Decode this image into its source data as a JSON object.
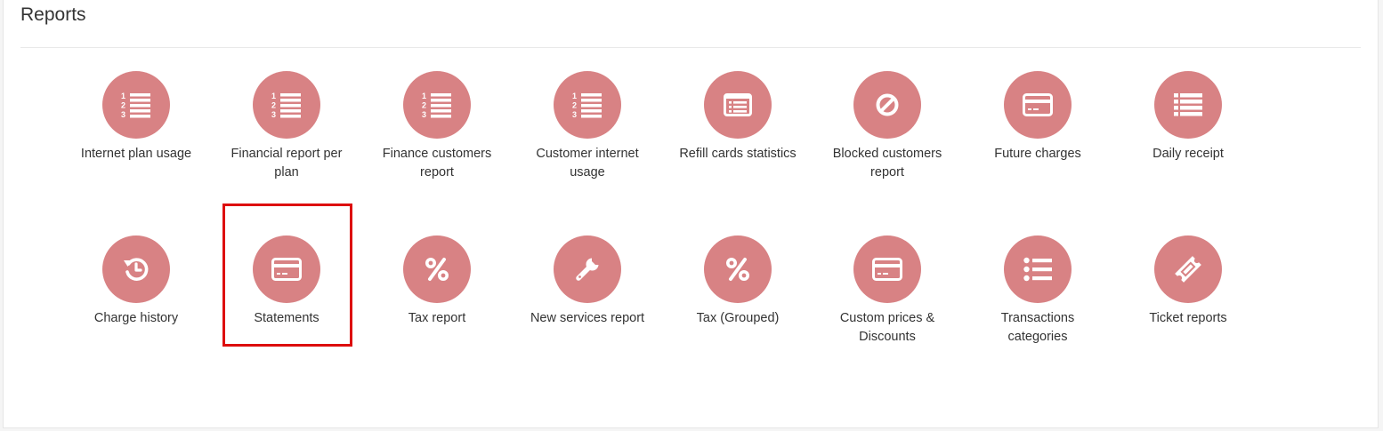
{
  "page": {
    "title": "Reports"
  },
  "colors": {
    "icon_circle": "#d88284",
    "highlight": "#dd0d0d",
    "icon_glyph": "#ffffff"
  },
  "reports": [
    {
      "label": "Internet plan usage",
      "icon": "ordered-list-icon"
    },
    {
      "label": "Financial report per plan",
      "icon": "ordered-list-icon"
    },
    {
      "label": "Finance customers report",
      "icon": "ordered-list-icon"
    },
    {
      "label": "Customer internet usage",
      "icon": "ordered-list-icon"
    },
    {
      "label": "Refill cards statistics",
      "icon": "list-alt-icon"
    },
    {
      "label": "Blocked customers report",
      "icon": "ban-icon"
    },
    {
      "label": "Future charges",
      "icon": "credit-card-icon"
    },
    {
      "label": "Daily receipt",
      "icon": "list-icon"
    },
    {
      "label": "Charge history",
      "icon": "history-icon"
    },
    {
      "label": "Statements",
      "icon": "credit-card-icon",
      "highlighted": true
    },
    {
      "label": "Tax report",
      "icon": "percent-icon"
    },
    {
      "label": "New services report",
      "icon": "wrench-icon"
    },
    {
      "label": "Tax (Grouped)",
      "icon": "percent-icon"
    },
    {
      "label": "Custom prices & Discounts",
      "icon": "credit-card-icon"
    },
    {
      "label": "Transactions categories",
      "icon": "list-ul-icon"
    },
    {
      "label": "Ticket reports",
      "icon": "ticket-icon"
    }
  ]
}
